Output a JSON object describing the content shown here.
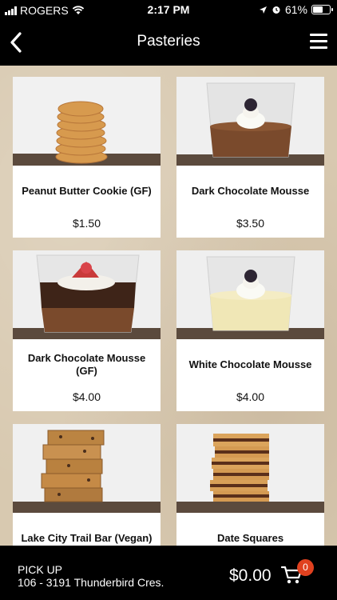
{
  "status": {
    "carrier": "ROGERS",
    "time": "2:17 PM",
    "battery": "61%",
    "battery_level": 0.61
  },
  "nav": {
    "title": "Pasteries",
    "back_icon": "chevron-left-icon",
    "menu_icon": "hamburger-menu-icon"
  },
  "products": [
    {
      "name": "Peanut Butter Cookie (GF)",
      "price": "$1.50"
    },
    {
      "name": "Dark Chocolate Mousse",
      "price": "$3.50"
    },
    {
      "name": "Dark Chocolate Mousse (GF)",
      "price": "$4.00"
    },
    {
      "name": "White Chocolate Mousse",
      "price": "$4.00"
    },
    {
      "name": "Lake City Trail Bar (Vegan)",
      "price": ""
    },
    {
      "name": "Date Squares",
      "price": ""
    }
  ],
  "footer": {
    "mode": "PICK UP",
    "address": "106 - 3191 Thunderbird Cres.",
    "total": "$0.00",
    "cart_count": "0"
  },
  "colors": {
    "bar_background": "#000000",
    "page_background": "#d8c9b0",
    "badge": "#e0411f"
  }
}
